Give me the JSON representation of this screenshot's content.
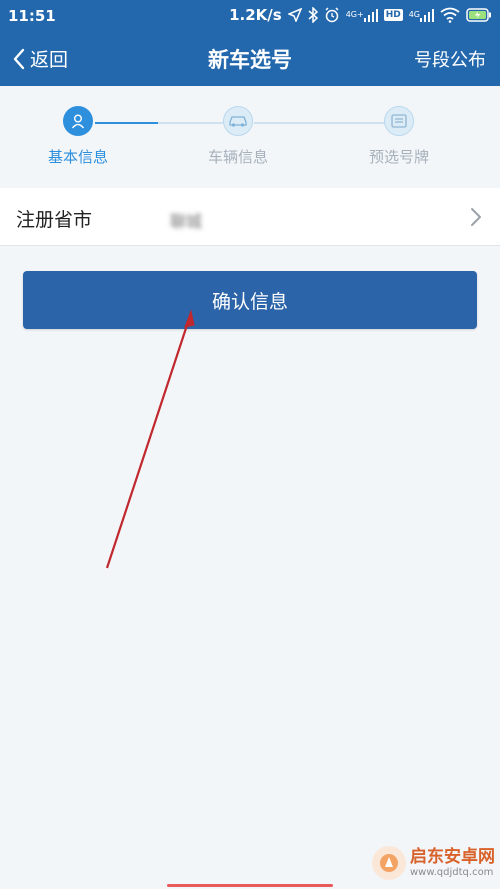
{
  "status_bar": {
    "time": "11:51",
    "net_speed": "1.2K/s",
    "signal1_label": "4G+",
    "hd_label": "HD",
    "signal2_label": "4G"
  },
  "navbar": {
    "back_label": "返回",
    "title": "新车选号",
    "right_label": "号段公布"
  },
  "steps": [
    {
      "label": "基本信息",
      "icon": "person-icon",
      "state": "active"
    },
    {
      "label": "车辆信息",
      "icon": "car-icon",
      "state": "inactive"
    },
    {
      "label": "预选号牌",
      "icon": "plate-icon",
      "state": "inactive"
    }
  ],
  "form": {
    "province_label": "注册省市",
    "province_value": "聊城"
  },
  "confirm_button_label": "确认信息",
  "watermark": {
    "title": "启东安卓网",
    "url": "www.qdjdtq.com"
  },
  "colors": {
    "primary": "#2368ad",
    "active_step": "#2e8fdd",
    "button": "#2b64a8",
    "annotation_arrow": "#c0282d"
  }
}
